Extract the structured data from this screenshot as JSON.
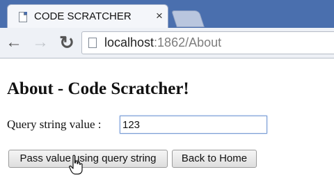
{
  "browser": {
    "tab": {
      "title": "CODE SCRATCHER",
      "close_glyph": "×"
    },
    "nav": {
      "back_glyph": "←",
      "forward_glyph": "→",
      "reload_glyph": "↻"
    },
    "url": {
      "host": "localhost",
      "path": ":1862/About"
    }
  },
  "page": {
    "heading": "About - Code Scratcher!",
    "query_label": "Query string value :",
    "query_value": "123",
    "buttons": {
      "pass": "Pass value using query string",
      "home": "Back to Home"
    }
  },
  "icons": {
    "tab_favicon": "page-icon",
    "omnibox_icon": "page-icon",
    "cursor": "hand-pointer-icon"
  },
  "colors": {
    "tabstrip": "#4a6fae",
    "input_focus": "#7a9cd3"
  }
}
